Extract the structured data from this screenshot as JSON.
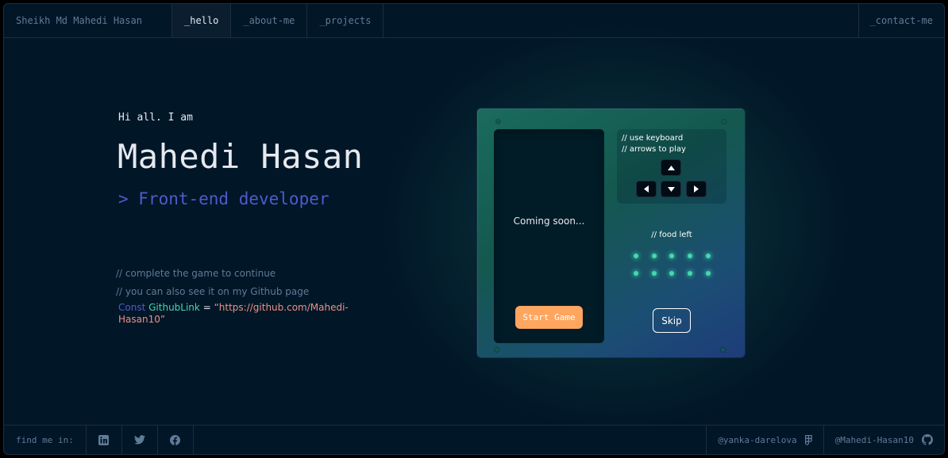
{
  "header": {
    "brand": "Sheikh Md Mahedi Hasan",
    "tabs": [
      {
        "label": "_hello",
        "active": true
      },
      {
        "label": "_about-me",
        "active": false
      },
      {
        "label": "_projects",
        "active": false
      }
    ],
    "contact": "_contact-me"
  },
  "intro": {
    "greeting": "Hi all. I am",
    "name": "Mahedi Hasan",
    "role": "> Front-end developer",
    "comment_slashes": "//",
    "comment1": "complete the game to continue",
    "comment2": "you can also see it on my Github page",
    "code_keyword": "Const",
    "code_var": "GithubLink",
    "code_op": " = ",
    "code_value": "“https://github.com/Mahedi-Hasan10”"
  },
  "game": {
    "screen_text": "Coming soon...",
    "start_label": "Start Game",
    "hint_line1": "// use keyboard",
    "hint_line2": "// arrows to play",
    "food_label": "// food left",
    "food_count": 10,
    "skip_label": "Skip",
    "keys": [
      "arrow-up-icon",
      "arrow-left-icon",
      "arrow-down-icon",
      "arrow-right-icon"
    ]
  },
  "footer": {
    "find_me": "find me in:",
    "socials": [
      "linkedin-icon",
      "twitter-icon",
      "facebook-icon"
    ],
    "designer": "@yanka-darelova",
    "github_user": "@Mahedi-Hasan10"
  },
  "colors": {
    "background": "#011627",
    "border": "#1E2D3D",
    "muted": "#607B96",
    "text": "#E5E9F0",
    "role_accent": "#4D5BCE",
    "var_accent": "#43D9AD",
    "string_accent": "#E99287",
    "button_orange": "#FEA55F"
  }
}
